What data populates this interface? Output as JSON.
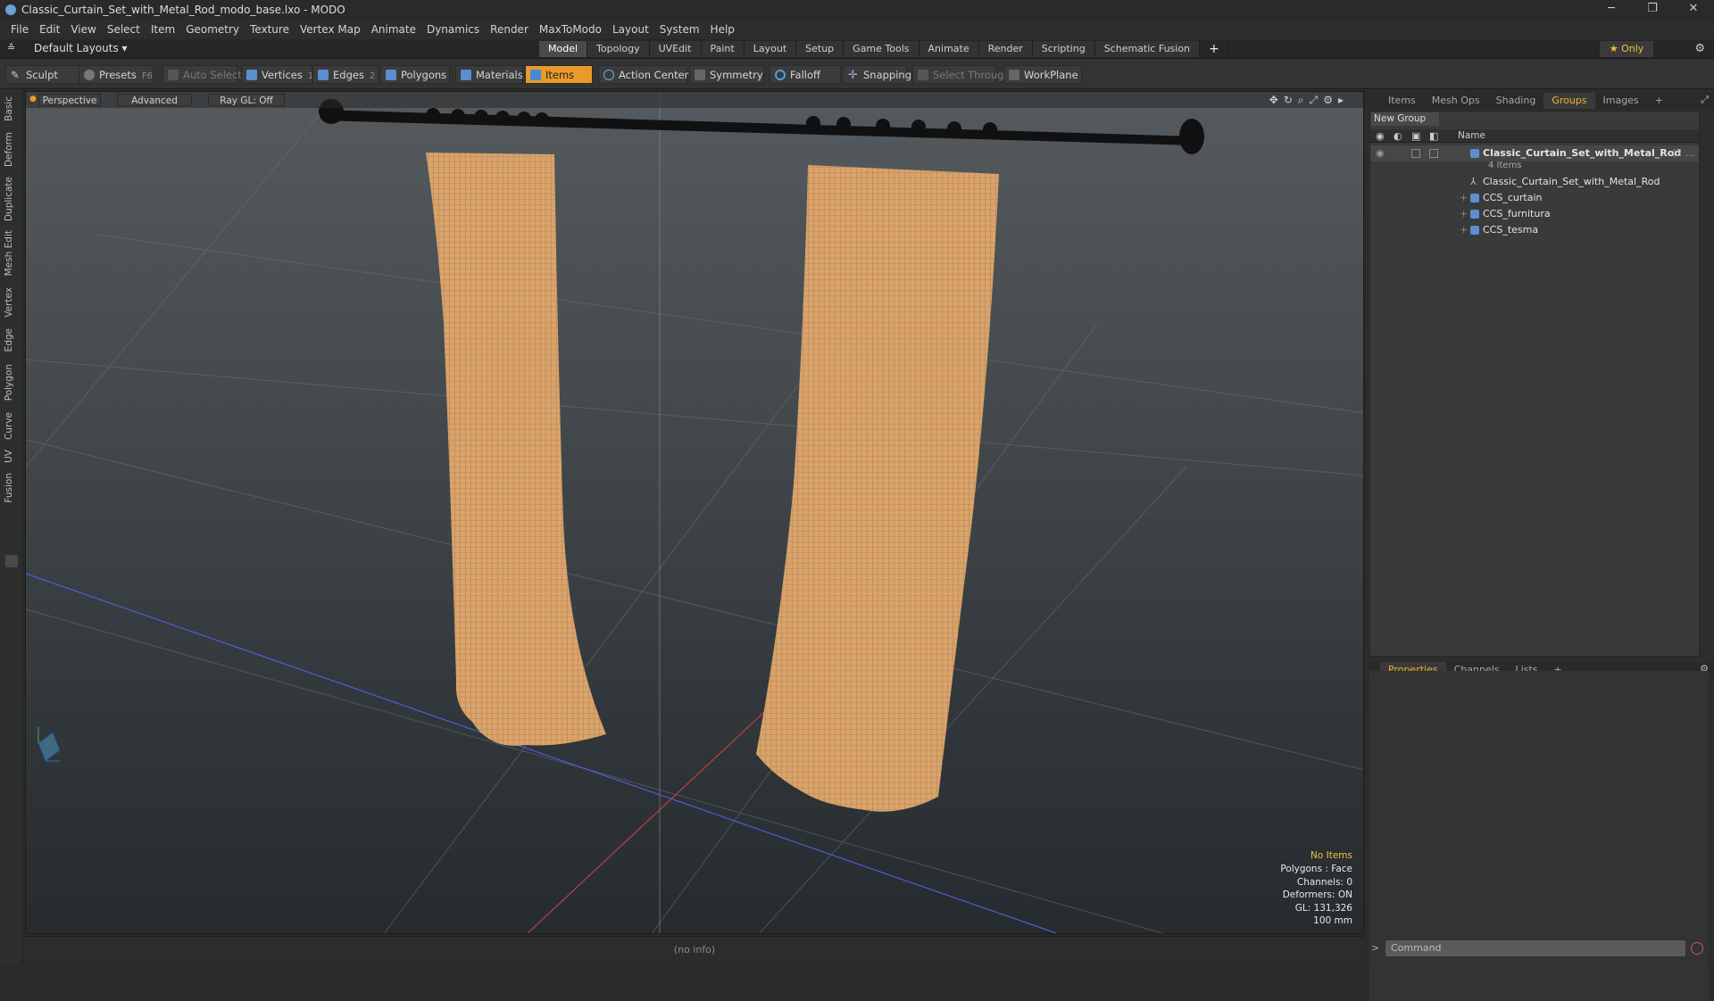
{
  "window": {
    "title": "Classic_Curtain_Set_with_Metal_Rod_modo_base.lxo - MODO",
    "min": "─",
    "max": "❐",
    "close": "✕"
  },
  "menu": [
    "File",
    "Edit",
    "View",
    "Select",
    "Item",
    "Geometry",
    "Texture",
    "Vertex Map",
    "Animate",
    "Dynamics",
    "Render",
    "MaxToModo",
    "Layout",
    "System",
    "Help"
  ],
  "layouts": {
    "label": "Default Layouts ▾"
  },
  "mode_tabs": [
    "Model",
    "Topology",
    "UVEdit",
    "Paint",
    "Layout",
    "Setup",
    "Game Tools",
    "Animate",
    "Render",
    "Scripting",
    "Schematic Fusion"
  ],
  "mode_add": "+",
  "only_label": "★  Only",
  "toolbar": {
    "sculpt": "Sculpt",
    "presets": "Presets",
    "presets_key": "F6",
    "auto_select": "Auto Select",
    "vertices": "Vertices",
    "vertices_num": "1",
    "edges": "Edges",
    "edges_num": "2",
    "polygons": "Polygons",
    "materials": "Materials",
    "items": "Items",
    "action_center": "Action Center",
    "symmetry": "Symmetry",
    "falloff": "Falloff",
    "snapping": "Snapping",
    "select_through": "Select Through",
    "workplane": "WorkPlane"
  },
  "left_tabs": [
    "Basic",
    "Deform",
    "Duplicate",
    "Mesh Edit",
    "Vertex",
    "Edge",
    "Polygon",
    "Curve",
    "UV",
    "Fusion"
  ],
  "viewport": {
    "view": "Perspective",
    "shading": "Advanced",
    "raygl": "Ray GL: Off",
    "stats": {
      "selection": "No Items",
      "polygons": "Polygons : Face",
      "channels": "Channels: 0",
      "deformers": "Deformers: ON",
      "gl": "GL: 131,326",
      "scale": "100 mm"
    }
  },
  "status": "(no info)",
  "right_tabs": [
    "Items",
    "Mesh Ops",
    "Shading",
    "Groups",
    "Images",
    "+"
  ],
  "groups": {
    "new_group": "New Group",
    "name_col": "Name",
    "root": "Classic_Curtain_Set_with_Metal_Rod",
    "root_suffix": "(2 ...",
    "count": "4 Items",
    "children": [
      "Classic_Curtain_Set_with_Metal_Rod",
      "CCS_curtain",
      "CCS_furnitura",
      "CCS_tesma"
    ]
  },
  "bottom_tabs": [
    "Properties",
    "Channels",
    "Lists",
    "+"
  ],
  "command_placeholder": "Command",
  "colors": {
    "accent": "#e89a2a",
    "curtain": "#d9a36b",
    "rod": "#111111"
  }
}
